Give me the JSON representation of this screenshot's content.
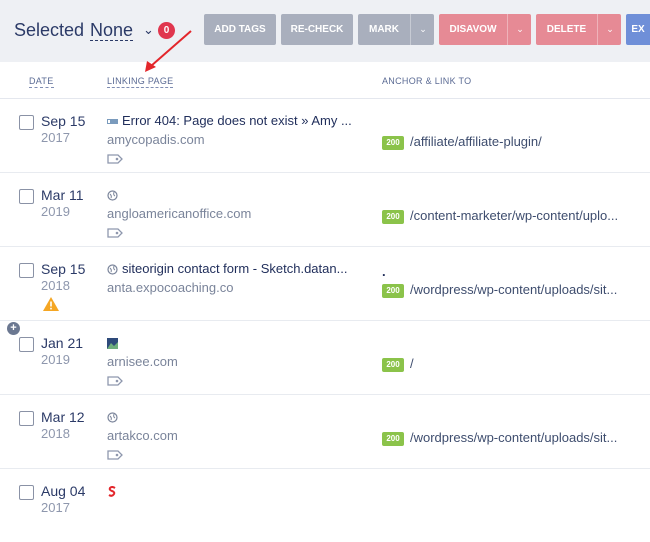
{
  "toolbar": {
    "selected_label": "Selected",
    "selected_value": "None",
    "selected_count": "0",
    "buttons": {
      "add_tags": "ADD TAGS",
      "recheck": "RE-CHECK",
      "mark": "MARK",
      "disavow": "DISAVOW",
      "delete": "DELETE",
      "export": "EX"
    }
  },
  "table": {
    "columns": {
      "date": "DATE",
      "linking_page": "LINKING PAGE",
      "anchor": "ANCHOR & LINK TO"
    },
    "rows": [
      {
        "date_md": "Sep 15",
        "date_y": "2017",
        "title": "Error 404: Page does not exist » Amy ...",
        "domain": "amycopadis.com",
        "anchor": "",
        "code": "200",
        "link": "/affiliate/affiliate-plugin/",
        "favicon": "page-favicon-icon",
        "warning": false
      },
      {
        "date_md": "Mar 11",
        "date_y": "2019",
        "title": "",
        "domain": "angloamericanoffice.com",
        "anchor": "",
        "code": "200",
        "link": "/content-marketer/wp-content/uplo...",
        "favicon": "globe-icon",
        "warning": false
      },
      {
        "date_md": "Sep 15",
        "date_y": "2018",
        "title": "siteorigin contact form - Sketch.datan...",
        "domain": "anta.expocoaching.co",
        "anchor": ".",
        "code": "200",
        "link": "/wordpress/wp-content/uploads/sit...",
        "favicon": "globe-icon",
        "warning": true
      },
      {
        "date_md": "Jan 21",
        "date_y": "2019",
        "title": "",
        "domain": "arnisee.com",
        "anchor": "",
        "code": "200",
        "link": "/",
        "favicon": "image-icon",
        "warning": false
      },
      {
        "date_md": "Mar 12",
        "date_y": "2018",
        "title": "",
        "domain": "artakco.com",
        "anchor": "",
        "code": "200",
        "link": "/wordpress/wp-content/uploads/sit...",
        "favicon": "globe-icon",
        "warning": false
      },
      {
        "date_md": "Aug 04",
        "date_y": "2017",
        "title": "",
        "domain": "",
        "anchor": "",
        "code": "",
        "link": "",
        "favicon": "red-s-favicon-icon",
        "warning": false
      }
    ]
  },
  "colors": {
    "accent": "#2b3a67",
    "danger": "#e68a95",
    "status_ok": "#8bc34a",
    "muted_button": "#a9afbd"
  }
}
